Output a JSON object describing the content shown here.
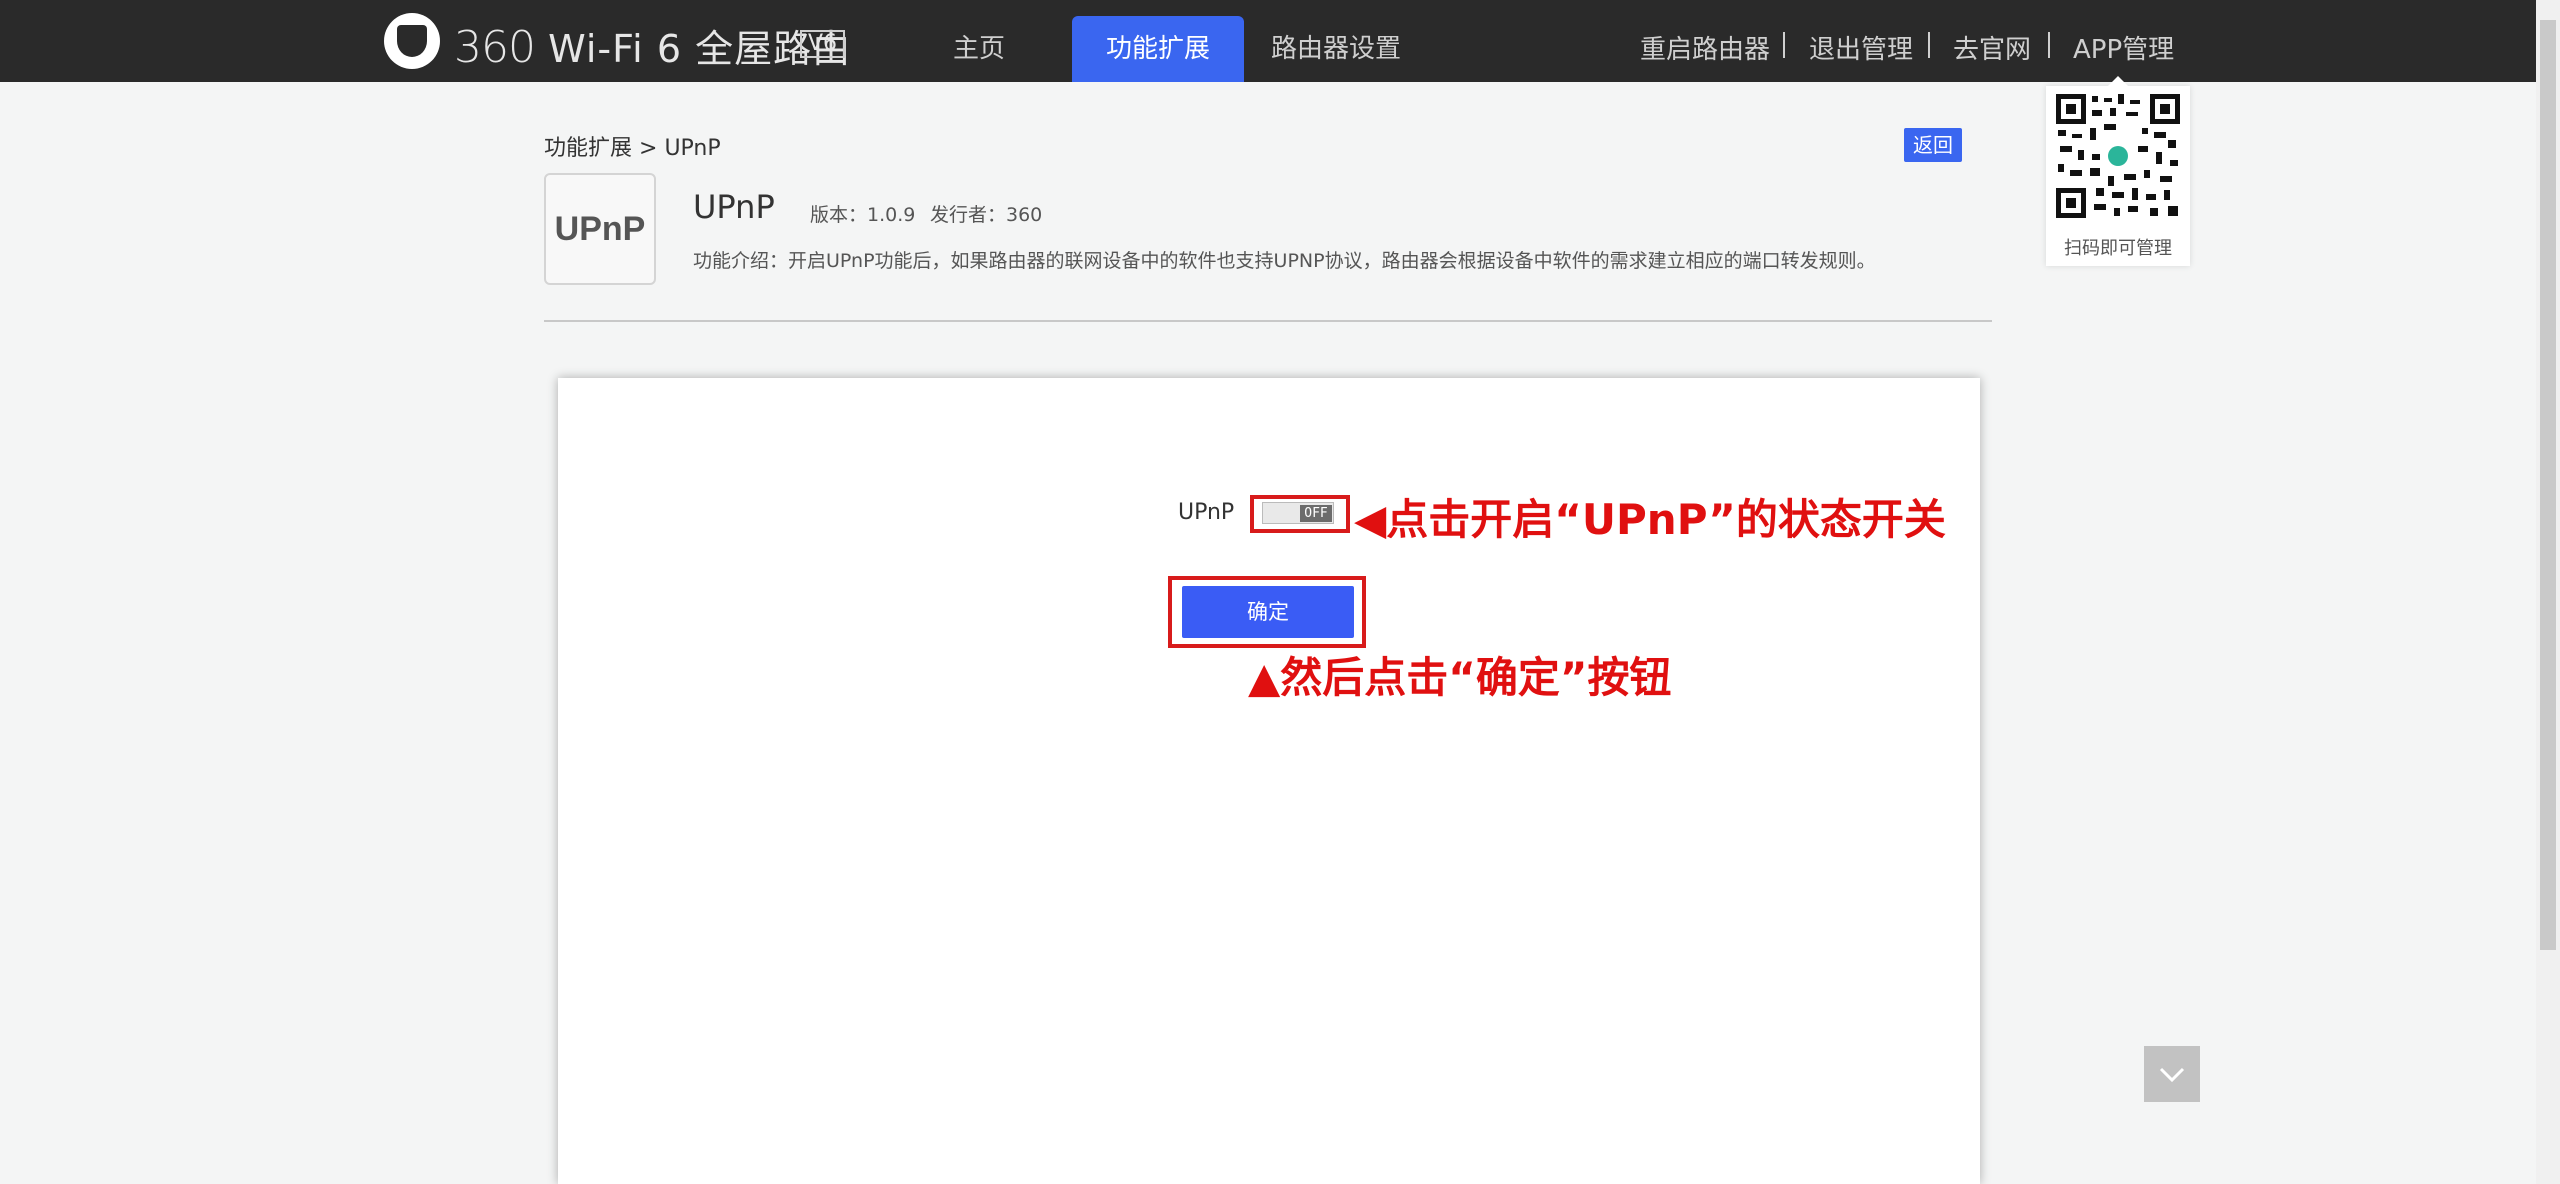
{
  "header": {
    "brand_number": "360",
    "brand_text": "Wi-Fi 6 全屋路由",
    "version_badge": "V6",
    "nav": [
      {
        "label": "主页",
        "active": false
      },
      {
        "label": "功能扩展",
        "active": true
      },
      {
        "label": "路由器设置",
        "active": false
      }
    ],
    "right_links": [
      "重启路由器",
      "退出管理",
      "去官网",
      "APP管理"
    ]
  },
  "breadcrumb": {
    "parent": "功能扩展",
    "separator": ">",
    "current": "UPnP"
  },
  "back_label": "返回",
  "app": {
    "icon_text": "UPnP",
    "title": "UPnP",
    "version": "版本：1.0.9",
    "publisher": "发行者：360",
    "description": "功能介绍：开启UPnP功能后，如果路由器的联网设备中的软件也支持UPNP协议，路由器会根据设备中软件的需求建立相应的端口转发规则。"
  },
  "qr": {
    "caption": "扫码即可管理"
  },
  "form": {
    "upnp_label": "UPnP",
    "toggle_state": "OFF",
    "confirm_label": "确定"
  },
  "annotations": {
    "toggle_note": "◀点击开启“UPnP”的状态开关",
    "confirm_note": "▲然后点击“确定”按钮"
  },
  "colors": {
    "accent": "#3a66f0",
    "topbar": "#2a2a2a",
    "annotation": "#e01010"
  },
  "icons": [
    "shield-logo-icon",
    "chevron-down-icon",
    "qr-code-icon"
  ]
}
